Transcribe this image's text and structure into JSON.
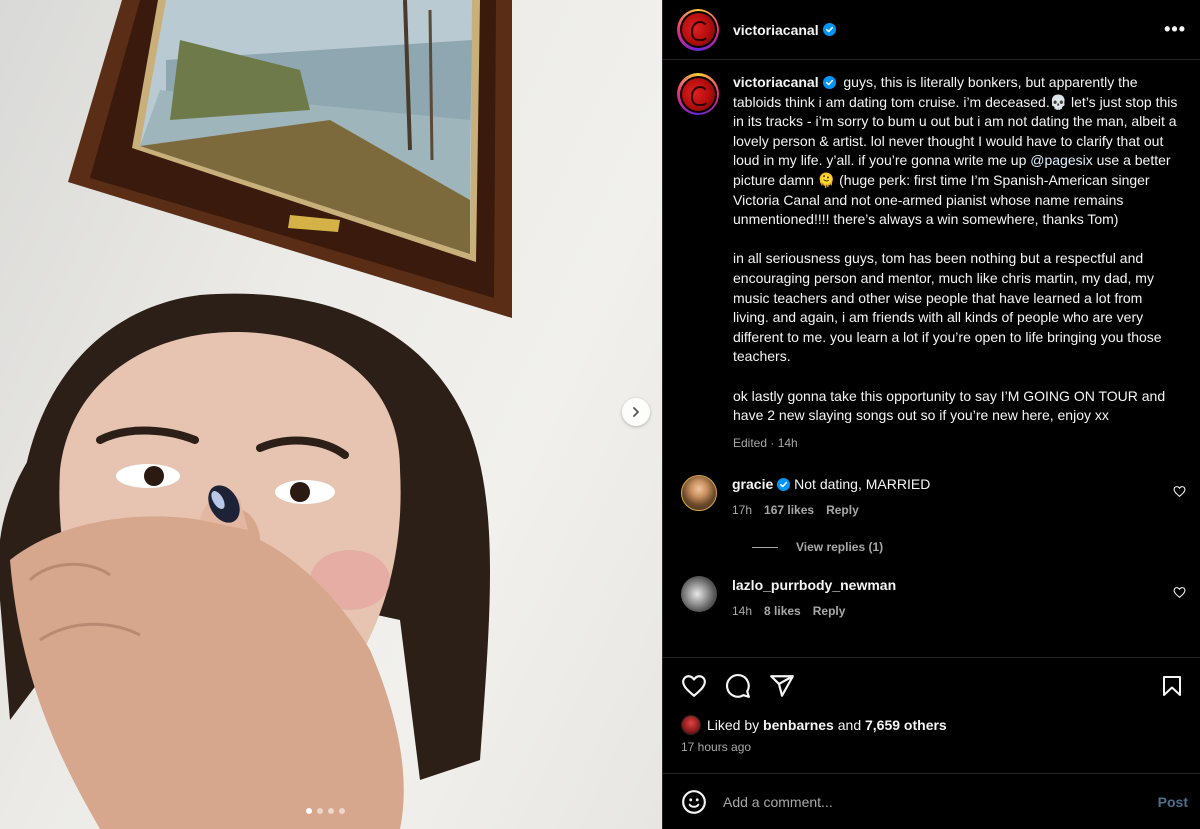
{
  "post": {
    "username": "victoriacanal",
    "caption": "guys, this is literally bonkers, but apparently the tabloids think i am dating tom cruise. i’m deceased.💀 let’s just stop this in its tracks - i’m sorry to bum u out but i am not dating the man, albeit a lovely person & artist. lol never thought I would have to clarify that out loud in my life. y’all. if you’re gonna write me up ",
    "caption_mention": "@pagesix",
    "caption_after": " use a better picture damn 🫠 (huge perk: first time I’m Spanish-American singer Victoria Canal and not one-armed pianist whose name remains unmentioned!!!! there’s always a win somewhere, thanks Tom)\n\nin all seriousness guys, tom has been nothing but a respectful and encouraging person and mentor, much like chris martin, my dad, my music teachers and other wise people that have learned a lot from living. and again, i am friends with all kinds of people who are very different to me. you learn a lot if you’re open to life bringing you those teachers.\n\nok lastly gonna take this opportunity to say I’M GOING ON TOUR and have 2 new slaying songs out so if you’re new here, enjoy xx",
    "edited": "Edited",
    "edited_time": "14h",
    "more_label": "•••"
  },
  "comments": [
    {
      "username": "gracie",
      "verified": true,
      "text": "Not dating, MARRIED",
      "time": "17h",
      "likes": "167 likes",
      "reply": "Reply",
      "view_replies": "View replies (1)"
    },
    {
      "username": "lazlo_purrbody_newman",
      "verified": false,
      "text": "",
      "time": "14h",
      "likes": "8 likes",
      "reply": "Reply"
    }
  ],
  "likes": {
    "prefix": "Liked by",
    "user": "benbarnes",
    "and": "and",
    "others": "7,659 others",
    "time_ago": "17 hours ago"
  },
  "add_comment": {
    "placeholder": "Add a comment...",
    "post_label": "Post"
  },
  "carousel": {
    "count": 4,
    "active": 0
  },
  "icons": [
    "verified-icon",
    "more-icon",
    "heart-icon",
    "comment-icon",
    "share-icon",
    "bookmark-icon",
    "emoji-icon",
    "chevron-right-icon"
  ],
  "colors": {
    "background": "#000000",
    "text": "#f5f5f5",
    "muted": "#a8a8a8",
    "verified": "#0095f6",
    "post_button": "#4d6e8f"
  }
}
